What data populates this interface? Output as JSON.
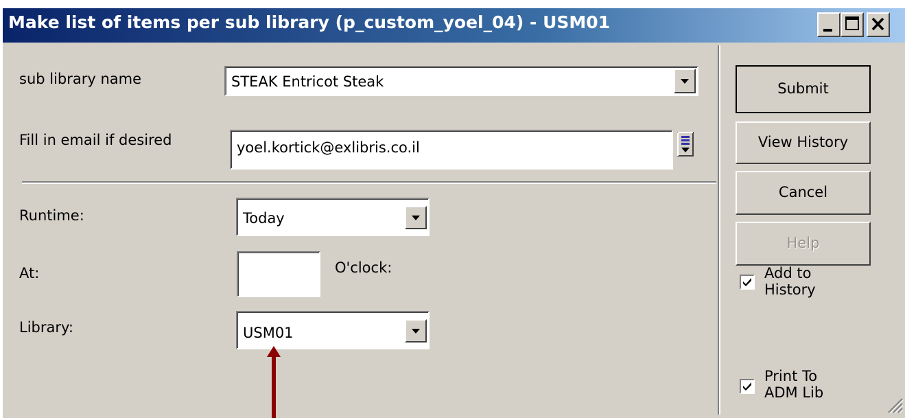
{
  "window": {
    "title": "Make list of items per sub library (p_custom_yoel_04) - USM01"
  },
  "form": {
    "sub_library": {
      "label": "sub library name",
      "value": "STEAK Entricot Steak"
    },
    "email": {
      "label": "Fill in email if desired",
      "value": "yoel.kortick@exlibris.co.il"
    },
    "runtime": {
      "label": "Runtime:",
      "value": "Today"
    },
    "at": {
      "label": "At:",
      "value": "",
      "suffix": "O'clock:"
    },
    "library": {
      "label": "Library:",
      "value": "USM01"
    }
  },
  "actions": {
    "submit": "Submit",
    "view_history": "View History",
    "cancel": "Cancel",
    "help": "Help"
  },
  "options": {
    "add_to_history": {
      "label": "Add to History",
      "checked": true
    },
    "print_to_adm": {
      "label": "Print To ADM Lib",
      "checked": true
    }
  },
  "annotation": {
    "arrow_color": "#8b0000"
  },
  "colors": {
    "title_start": "#0a246a",
    "title_end": "#a6caf0",
    "face": "#d4d0c8"
  }
}
